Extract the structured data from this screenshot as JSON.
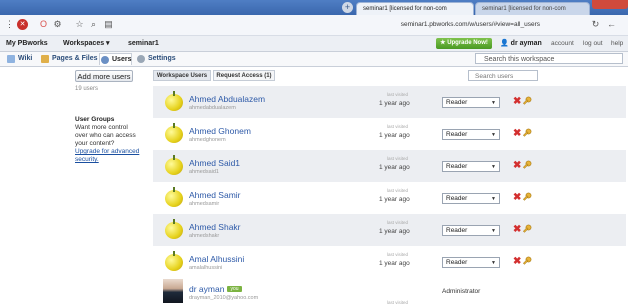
{
  "browser": {
    "tabs": [
      {
        "label": "seminar1 [licensed for non-com"
      },
      {
        "label": "seminar1 [licensed for non-com"
      }
    ],
    "url": "seminar1.pbworks.com/w/users/#view=all_users"
  },
  "pbbar": {
    "brand": "My PBworks",
    "workspaces": "Workspaces ▾",
    "workspace_name": "seminar1",
    "upgrade": "Upgrade Now!",
    "user": "dr ayman",
    "account": "account",
    "logout": "log out",
    "help": "help"
  },
  "nav": {
    "tabs": [
      {
        "label": "Wiki",
        "color": "#8fb3e0"
      },
      {
        "label": "Pages & Files",
        "color": "#e0b04a"
      },
      {
        "label": "Users",
        "color": "#6a8fc4"
      },
      {
        "label": "Settings",
        "color": "#9aa7b6"
      }
    ],
    "search_placeholder": "Search this workspace"
  },
  "sidebar": {
    "add_button": "Add more users",
    "user_count": "19 users",
    "groups_title": "User Groups",
    "groups_text": "Want more control over who can access your content?",
    "groups_link": "Upgrade for advanced security."
  },
  "subtabs": {
    "workspace_users": "Workspace Users",
    "access_requests": "Request Access (1)",
    "search_placeholder": "Search users"
  },
  "users": [
    {
      "name": "Ahmed Abdualazem",
      "handle": "ahmedabdualazem",
      "last_label": "last visited",
      "last": "1 year ago",
      "role": "Reader"
    },
    {
      "name": "Ahmed Ghonem",
      "handle": "ahmedghonem",
      "last_label": "last visited",
      "last": "1 year ago",
      "role": "Reader"
    },
    {
      "name": "Ahmed Said1",
      "handle": "ahmedsaid1",
      "last_label": "last visited",
      "last": "1 year ago",
      "role": "Reader"
    },
    {
      "name": "Ahmed Samir",
      "handle": "ahmedsamir",
      "last_label": "last visited",
      "last": "1 year ago",
      "role": "Reader"
    },
    {
      "name": "Ahmed Shakr",
      "handle": "ahmedshakr",
      "last_label": "last visited",
      "last": "1 year ago",
      "role": "Reader"
    },
    {
      "name": "Amal Alhussini",
      "handle": "amalalhussini",
      "last_label": "last visited",
      "last": "1 year ago",
      "role": "Reader"
    }
  ],
  "admin": {
    "name": "dr ayman",
    "badge": "you",
    "email": "drayman_2010@yahoo.com",
    "last_label": "last visited",
    "role": "Administrator"
  }
}
